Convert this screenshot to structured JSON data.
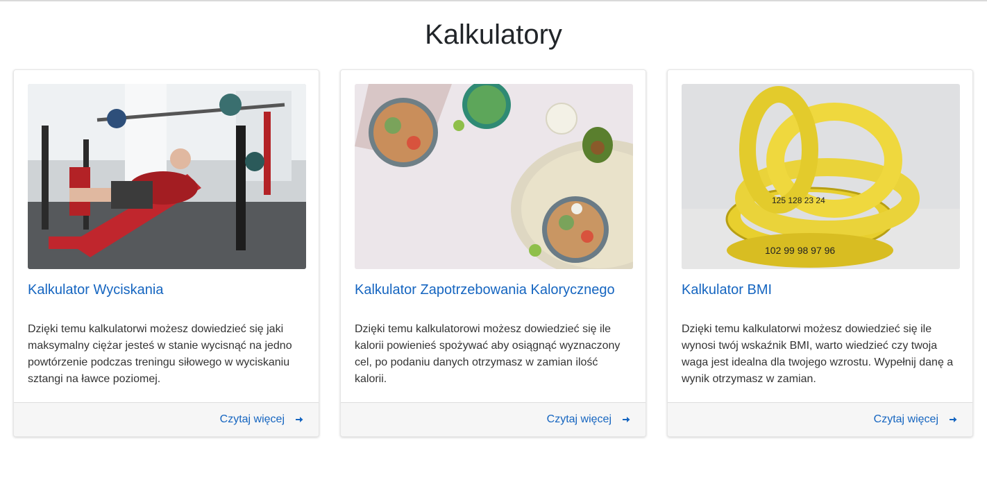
{
  "page": {
    "title": "Kalkulatory"
  },
  "cards": [
    {
      "title": "Kalkulator Wyciskania",
      "text": "Dzięki temu kalkulatorwi możesz dowiedzieć się jaki maksymalny ciężar jesteś w stanie wycisnąć na jedno powtórzenie podczas treningu siłowego w wyciskaniu sztangi na ławce poziomej.",
      "link": "Czytaj więcej",
      "image": "gym-bench-press-photo"
    },
    {
      "title": "Kalkulator Zapotrzebowania Kalorycznego",
      "text": "Dzięki temu kalkulatorowi możesz dowiedzieć się ile kalorii powienieś spożywać aby osiągnąć wyznaczony cel, po podaniu danych otrzymasz w zamian ilość kalorii.",
      "link": "Czytaj więcej",
      "image": "healthy-food-bowls-photo"
    },
    {
      "title": "Kalkulator BMI",
      "text": "Dzięki temu kalkulatorwi możesz dowiedzieć się ile wynosi twój wskaźnik BMI, warto wiedzieć czy twoja waga jest idealna dla twojego wzrostu. Wypełnij danę a wynik otrzymasz w zamian.",
      "link": "Czytaj więcej",
      "image": "measuring-tape-photo"
    }
  ],
  "colors": {
    "link": "#1565c0",
    "footer_bg": "#f6f6f6"
  },
  "icons": {
    "more": "arrow-right-icon"
  }
}
